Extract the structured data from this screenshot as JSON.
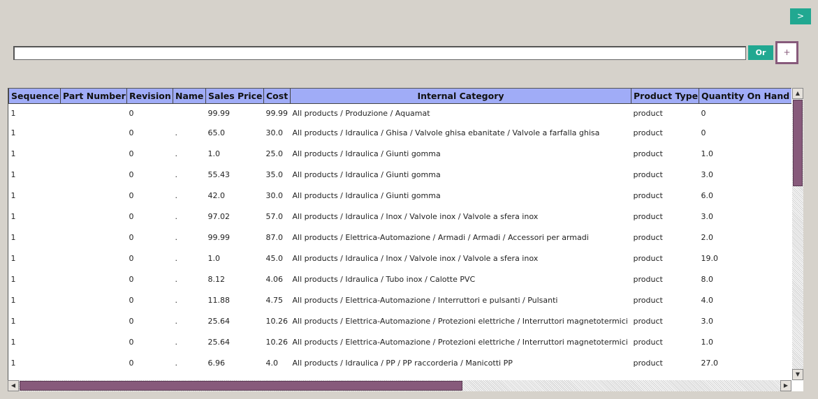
{
  "nav": {
    "next_label": ">"
  },
  "search": {
    "value": "",
    "placeholder": ""
  },
  "filter": {
    "or_label": "Or",
    "add_label": "+"
  },
  "grid": {
    "columns": [
      "Sequence",
      "Part Number",
      "Revision",
      "Name",
      "Sales Price",
      "Cost",
      "Internal Category",
      "Product Type",
      "Quantity On Hand"
    ],
    "rows": [
      [
        "1",
        "",
        "0",
        "",
        "99.99",
        "99.99",
        "All products / Produzione / Aquamat",
        "product",
        "0"
      ],
      [
        "1",
        "",
        "0",
        ".",
        "65.0",
        "30.0",
        "All products / Idraulica / Ghisa / Valvole ghisa ebanitate / Valvole a farfalla ghisa",
        "product",
        "0"
      ],
      [
        "1",
        "",
        "0",
        ".",
        "1.0",
        "25.0",
        "All products / Idraulica / Giunti gomma",
        "product",
        "1.0"
      ],
      [
        "1",
        "",
        "0",
        ".",
        "55.43",
        "35.0",
        "All products / Idraulica / Giunti gomma",
        "product",
        "3.0"
      ],
      [
        "1",
        "",
        "0",
        ".",
        "42.0",
        "30.0",
        "All products / Idraulica / Giunti gomma",
        "product",
        "6.0"
      ],
      [
        "1",
        "",
        "0",
        ".",
        "97.02",
        "57.0",
        "All products / Idraulica / Inox / Valvole inox / Valvole a sfera inox",
        "product",
        "3.0"
      ],
      [
        "1",
        "",
        "0",
        ".",
        "99.99",
        "87.0",
        "All products / Elettrica-Automazione / Armadi / Armadi / Accessori per armadi",
        "product",
        "2.0"
      ],
      [
        "1",
        "",
        "0",
        ".",
        "1.0",
        "45.0",
        "All products / Idraulica / Inox / Valvole inox / Valvole a sfera inox",
        "product",
        "19.0"
      ],
      [
        "1",
        "",
        "0",
        ".",
        "8.12",
        "4.06",
        "All products / Idraulica / Tubo inox / Calotte PVC",
        "product",
        "8.0"
      ],
      [
        "1",
        "",
        "0",
        ".",
        "11.88",
        "4.75",
        "All products / Elettrica-Automazione / Interruttori e pulsanti / Pulsanti",
        "product",
        "4.0"
      ],
      [
        "1",
        "",
        "0",
        ".",
        "25.64",
        "10.26",
        "All products / Elettrica-Automazione / Protezioni elettriche / Interruttori magnetotermici",
        "product",
        "3.0"
      ],
      [
        "1",
        "",
        "0",
        ".",
        "25.64",
        "10.26",
        "All products / Elettrica-Automazione / Protezioni elettriche / Interruttori magnetotermici",
        "product",
        "1.0"
      ],
      [
        "1",
        "",
        "0",
        ".",
        "6.96",
        "4.0",
        "All products / Idraulica / PP / PP raccorderia / Manicotti PP",
        "product",
        "27.0"
      ]
    ]
  },
  "colors": {
    "accent": "#21a891",
    "brand": "#875a7b",
    "header_bg": "#a0acf7"
  }
}
